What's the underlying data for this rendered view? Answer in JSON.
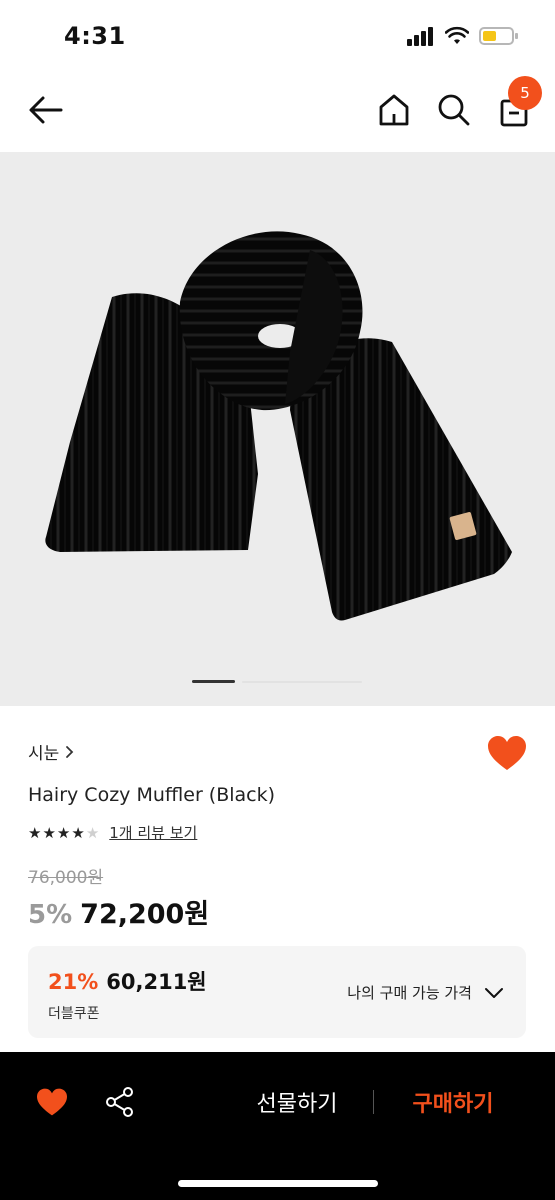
{
  "status_bar": {
    "time": "4:31",
    "battery_color": "#f5c518"
  },
  "nav": {
    "back_icon": "arrow-left-icon",
    "home_icon": "home-icon",
    "search_icon": "search-icon",
    "cart_icon": "shopping-bag-icon",
    "cart_count": "5"
  },
  "gallery": {
    "image": "black knit ribbed scarf",
    "current_slide_fraction": 0.25
  },
  "product": {
    "brand": "시눈",
    "name": "Hairy Cozy Muffler (Black)",
    "rating": 4,
    "rating_max": 5,
    "review_link": "1개 리뷰 보기",
    "original_price": "76,000원",
    "discount_rate": "5%",
    "price": "72,200원"
  },
  "coupon": {
    "rate": "21%",
    "price": "60,211원",
    "label": "더블쿠폰",
    "toggle_label": "나의 구매 가능 가격"
  },
  "bottom_bar": {
    "gift_label": "선물하기",
    "buy_label": "구매하기"
  },
  "colors": {
    "accent": "#f2501c",
    "bottom_bar_bg": "#000000",
    "hero_bg": "#ececec"
  }
}
